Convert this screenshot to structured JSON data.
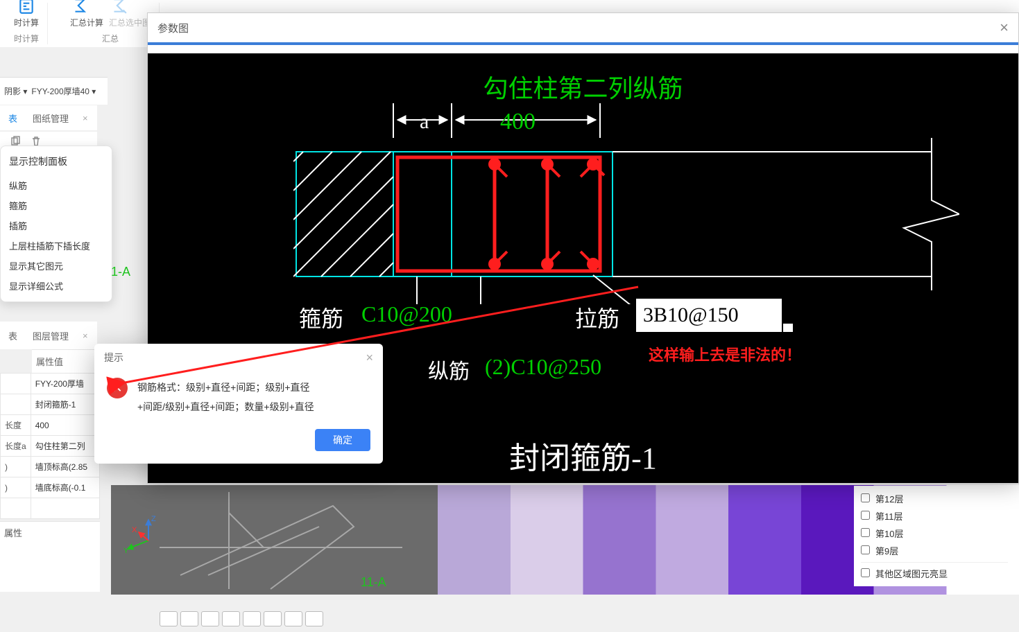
{
  "toolbar": {
    "groups": [
      {
        "items": [
          {
            "label": "时计算"
          }
        ],
        "group_label": "时计算"
      },
      {
        "items": [
          {
            "label": "汇总计算"
          },
          {
            "label": "汇总选中图"
          }
        ],
        "group_label": "汇总"
      }
    ]
  },
  "divider": {
    "left": "阴影 ▾",
    "right": "FYY-200厚墙40 ▾"
  },
  "tabs": {
    "items": [
      {
        "label": "表",
        "active": true
      },
      {
        "label": "图纸管理",
        "active": false
      }
    ]
  },
  "control_panel": {
    "title": "显示控制面板",
    "items": [
      "纵筋",
      "箍筋",
      "插筋",
      "上层柱插筋下插长度",
      "显示其它图元",
      "显示详细公式"
    ]
  },
  "marker_1a": "1-A",
  "marker_11a": "11-A",
  "layer_tabs": {
    "items": [
      {
        "label": "表"
      },
      {
        "label": "图层管理"
      }
    ]
  },
  "prop_header": "属性值",
  "property_table": {
    "rows": [
      {
        "name": "",
        "value": "FYY-200厚墙"
      },
      {
        "name": "",
        "value": "封闭箍筋-1"
      },
      {
        "name": "长度",
        "value": "400"
      },
      {
        "name": "长度a",
        "value": "勾住柱第二列"
      },
      {
        "name": ")",
        "value": "墙顶标高(2.85"
      },
      {
        "name": ")",
        "value": "墙底标高(-0.1"
      },
      {
        "name": "",
        "value": ""
      }
    ]
  },
  "prop_attr_footer": "属性",
  "right_layers": {
    "items": [
      "第12层",
      "第11层",
      "第10层",
      "第9层"
    ],
    "footer": "其他区域图元亮显"
  },
  "param_window": {
    "title": "参数图",
    "canvas": {
      "top_title": "勾住柱第二列纵筋",
      "dim_a": "a",
      "dim_400": "400",
      "gujin_label": "箍筋",
      "gujin_value": "C10@200",
      "lajin_label": "拉筋",
      "lajin_input": "3B10@150",
      "zongjin_label": "纵筋",
      "zongjin_value": "(2)C10@250",
      "remark": "这样输上去是非法的！",
      "bottom_title": "封闭箍筋-1"
    }
  },
  "msgbox": {
    "title": "提示",
    "line1": "钢筋格式：级别+直径+间距；级别+直径",
    "line2": "+间距/级别+直径+间距；数量+级别+直径",
    "ok": "确定"
  }
}
